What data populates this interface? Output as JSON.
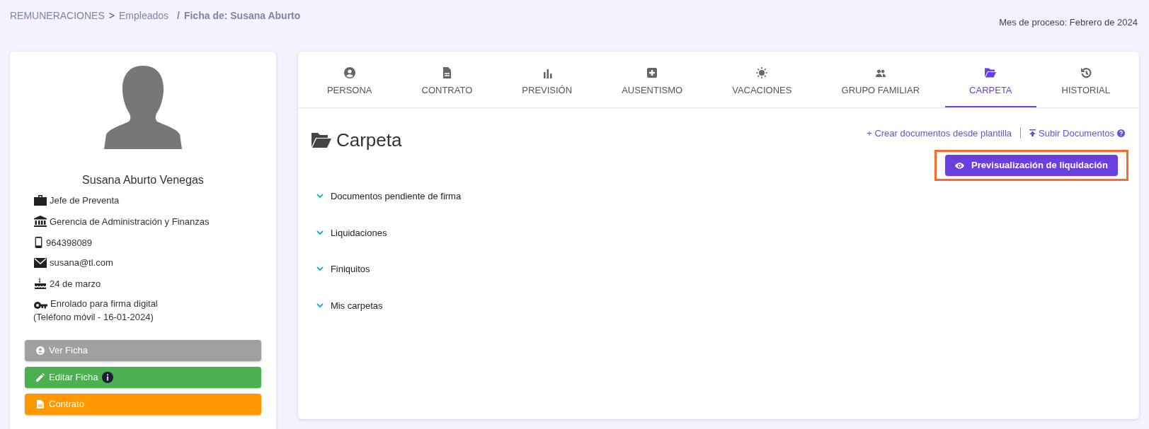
{
  "breadcrumb": {
    "root": "REMUNERACIONES",
    "separator_1": ">",
    "parent": "Empleados",
    "separator_2": "/",
    "current": "Ficha de: Susana Aburto"
  },
  "process_month": "Mes de proceso: Febrero de 2024",
  "profile": {
    "name": "Susana Aburto Venegas",
    "details": [
      {
        "kind": "job",
        "text": "Jefe de Preventa"
      },
      {
        "kind": "department",
        "text": "Gerencia de Administración y Finanzas"
      },
      {
        "kind": "phone",
        "text": "964398089"
      },
      {
        "kind": "email",
        "text": "susana@tl.com"
      },
      {
        "kind": "birthday",
        "text": "24 de marzo"
      },
      {
        "kind": "signature",
        "text": "Enrolado para firma digital",
        "note": "(Teléfono móvil - 16-01-2024)"
      }
    ],
    "buttons": [
      {
        "kind": "view",
        "label": "Ver Ficha",
        "info": false
      },
      {
        "kind": "edit",
        "label": "Editar Ficha",
        "info": true
      },
      {
        "kind": "contract",
        "label": "Contrato",
        "info": false
      }
    ]
  },
  "tabs": [
    {
      "label": "PERSONA",
      "selected": false
    },
    {
      "label": "CONTRATO",
      "selected": false
    },
    {
      "label": "PREVISIÓN",
      "selected": false
    },
    {
      "label": "AUSENTISMO",
      "selected": false
    },
    {
      "label": "VACACIONES",
      "selected": false
    },
    {
      "label": "GRUPO FAMILIAR",
      "selected": false
    },
    {
      "label": "CARPETA",
      "selected": true
    },
    {
      "label": "HISTORIAL",
      "selected": false
    }
  ],
  "panel": {
    "title": "Carpeta",
    "links": [
      "+ Crear documentos desde plantilla",
      "Subir Documentos"
    ],
    "preview_button": {
      "label": "Previsualización de liquidación",
      "highlighted": true
    },
    "sections": [
      "Documentos pendiente de firma",
      "Liquidaciones",
      "Finiquitos",
      "Mis carpetas"
    ]
  }
}
